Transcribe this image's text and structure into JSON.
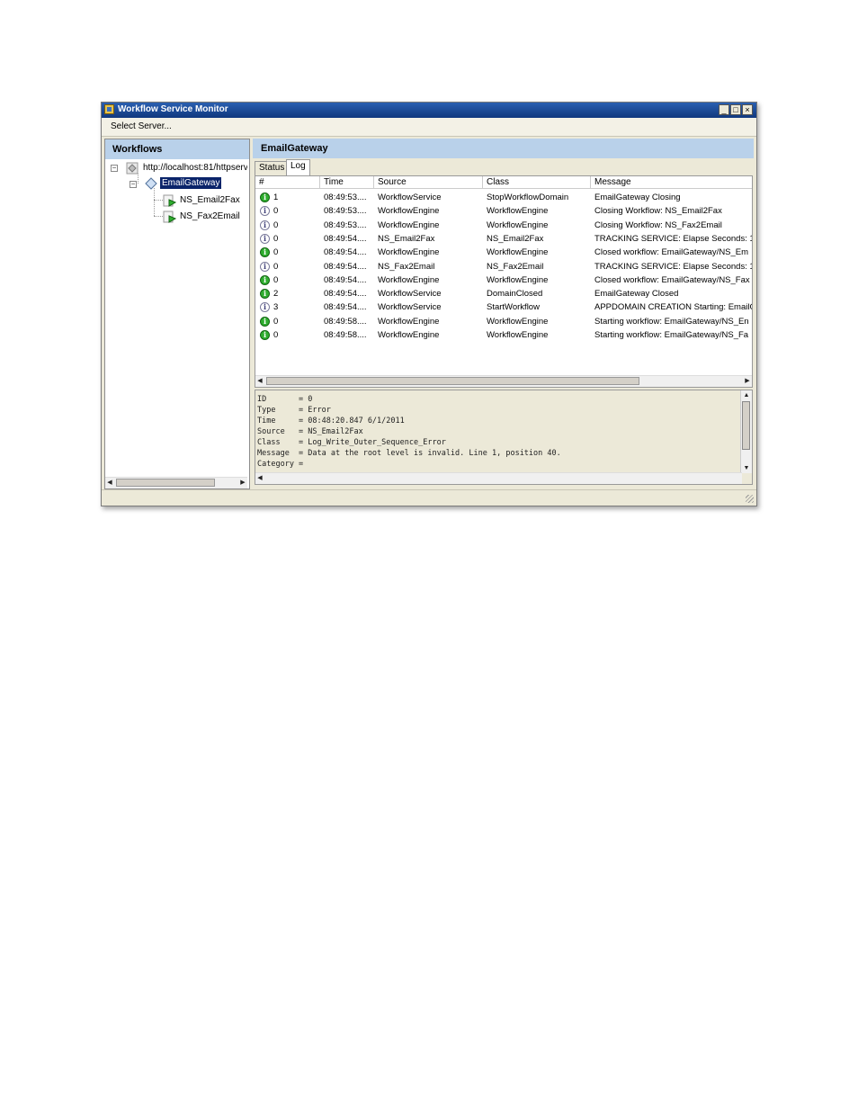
{
  "window": {
    "title": "Workflow Service Monitor",
    "minimize_glyph": "_",
    "maximize_glyph": "□",
    "close_glyph": "×"
  },
  "menu": {
    "select_server": "Select Server..."
  },
  "left_pane": {
    "title": "Workflows",
    "tree": {
      "root": "http://localhost:81/httpserv",
      "gateway": "EmailGateway",
      "children": [
        "NS_Email2Fax",
        "NS_Fax2Email"
      ]
    }
  },
  "right_pane": {
    "title": "EmailGateway",
    "tabs": [
      "Status",
      "Log"
    ],
    "active_tab": "Log",
    "columns": [
      "#",
      "Time",
      "Source",
      "Class",
      "Message"
    ],
    "rows": [
      {
        "icon": "ok",
        "num": "1",
        "time": "08:49:53....",
        "source": "WorkflowService",
        "class": "StopWorkflowDomain",
        "message": "EmailGateway Closing"
      },
      {
        "icon": "info",
        "num": "0",
        "time": "08:49:53....",
        "source": "WorkflowEngine",
        "class": "WorkflowEngine",
        "message": "Closing Workflow: NS_Email2Fax"
      },
      {
        "icon": "info",
        "num": "0",
        "time": "08:49:53....",
        "source": "WorkflowEngine",
        "class": "WorkflowEngine",
        "message": "Closing Workflow: NS_Fax2Email"
      },
      {
        "icon": "info",
        "num": "0",
        "time": "08:49:54....",
        "source": "NS_Email2Fax",
        "class": "NS_Email2Fax",
        "message": "TRACKING SERVICE: Elapse Seconds: 1"
      },
      {
        "icon": "ok",
        "num": "0",
        "time": "08:49:54....",
        "source": "WorkflowEngine",
        "class": "WorkflowEngine",
        "message": "Closed workflow: EmailGateway/NS_Em"
      },
      {
        "icon": "info",
        "num": "0",
        "time": "08:49:54....",
        "source": "NS_Fax2Email",
        "class": "NS_Fax2Email",
        "message": "TRACKING SERVICE: Elapse Seconds: 1"
      },
      {
        "icon": "ok",
        "num": "0",
        "time": "08:49:54....",
        "source": "WorkflowEngine",
        "class": "WorkflowEngine",
        "message": "Closed workflow: EmailGateway/NS_Fax"
      },
      {
        "icon": "ok",
        "num": "2",
        "time": "08:49:54....",
        "source": "WorkflowService",
        "class": "DomainClosed",
        "message": "EmailGateway Closed"
      },
      {
        "icon": "info",
        "num": "3",
        "time": "08:49:54....",
        "source": "WorkflowService",
        "class": "StartWorkflow",
        "message": "APPDOMAIN CREATION Starting: EmailG"
      },
      {
        "icon": "ok",
        "num": "0",
        "time": "08:49:58....",
        "source": "WorkflowEngine",
        "class": "WorkflowEngine",
        "message": "Starting workflow: EmailGateway/NS_En"
      },
      {
        "icon": "ok",
        "num": "0",
        "time": "08:49:58....",
        "source": "WorkflowEngine",
        "class": "WorkflowEngine",
        "message": "Starting workflow: EmailGateway/NS_Fa"
      }
    ],
    "detail": [
      "ID       = 0",
      "Type     = Error",
      "Time     = 08:48:20.847 6/1/2011",
      "Source   = NS_Email2Fax",
      "Class    = Log_Write_Outer_Sequence_Error",
      "Message  = Data at the root level is invalid. Line 1, position 40.",
      "Category ="
    ]
  },
  "colors": {
    "header_blue": "#b9d1ea",
    "title_bar": "#10387e",
    "selection": "#0a246a",
    "ok_icon": "#2fae2f"
  }
}
